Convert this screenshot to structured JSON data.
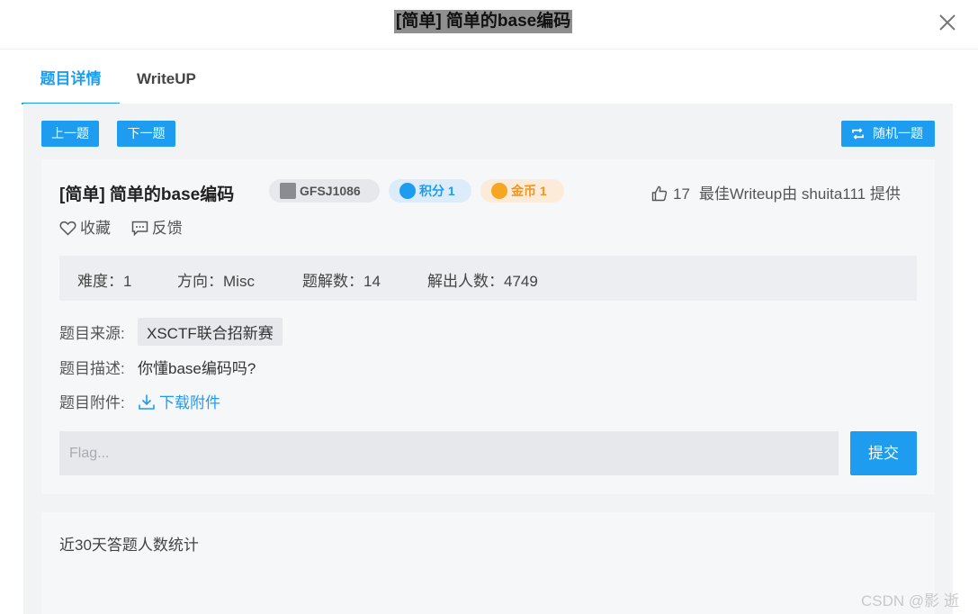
{
  "dialog": {
    "title": "[简单] 简单的base编码"
  },
  "tabs": [
    {
      "label": "题目详情"
    },
    {
      "label": "WriteUP"
    }
  ],
  "toolbar": {
    "prev_label": "上一题",
    "next_label": "下一题",
    "random_label": "随机一题"
  },
  "challenge": {
    "title": "[简单] 简单的base编码",
    "id_badge": "GFSJ1086",
    "score_badge": "积分 1",
    "coin_badge": "金币 1",
    "like_count": "17",
    "best_writeup": "最佳Writeup由 shuita111 提供",
    "favorite_label": "收藏",
    "feedback_label": "反馈"
  },
  "stats": {
    "difficulty": "难度：1",
    "direction": "方向：Misc",
    "solved": "题解数：14",
    "solvers": "解出人数：4749"
  },
  "meta": {
    "source_label": "题目来源:",
    "source_value": "XSCTF联合招新赛",
    "desc_label": "题目描述:",
    "desc_value": "你懂base编码吗?",
    "attach_label": "题目附件:",
    "attach_link": "下载附件"
  },
  "flag": {
    "placeholder": "Flag...",
    "submit_label": "提交"
  },
  "chart_section": {
    "title": "近30天答题人数统计"
  },
  "watermark": "CSDN @影 逝",
  "colors": {
    "accent": "#1e9cf0",
    "coin": "#f0951e",
    "panel_bg": "#f2f3f5"
  },
  "icons": {
    "close": "close-icon",
    "random": "shuffle-icon",
    "like": "thumbs-up-icon",
    "favorite": "heart-icon",
    "feedback": "comment-icon",
    "download": "download-icon"
  }
}
